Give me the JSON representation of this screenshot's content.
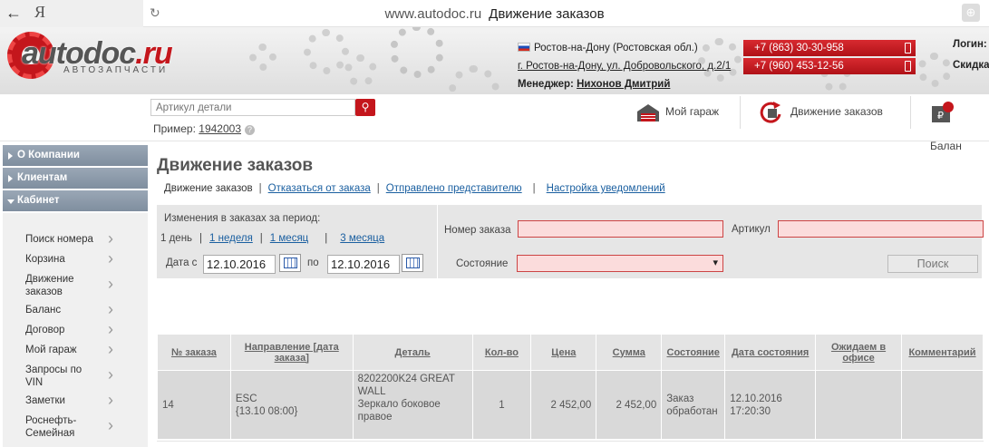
{
  "browser": {
    "back": "←",
    "yandex": "Я",
    "reload": "↻",
    "domain": "www.autodoc.ru",
    "title": "Движение заказов",
    "globe": "⊕"
  },
  "header": {
    "logo_main": "autodoc",
    "logo_ru": ".ru",
    "logo_sub": "АВТОЗАПЧАСТИ",
    "region": "Ростов-на-Дону (Ростовская обл.)",
    "address": "г. Ростов-на-Дону, ул. Добровольского, д.2/1",
    "manager_label": "Менеджер:",
    "manager_name": "Нихонов Дмитрий",
    "phones": [
      "+7 (863) 30-30-958",
      "+7 (960) 453-12-56"
    ],
    "login_label": "Логин:",
    "discount_label": "Скидка"
  },
  "search": {
    "placeholder": "Артикул детали",
    "example_label": "Пример:",
    "example_value": "1942003",
    "help": "?"
  },
  "topnav": {
    "garage": "Мой гараж",
    "orders": "Движение заказов",
    "balance": "Балан"
  },
  "sidebar": {
    "sections": [
      "О Компании",
      "Клиентам",
      "Кабинет"
    ],
    "items": [
      "Поиск номера",
      "Корзина",
      "Движение заказов",
      "Баланс",
      "Договор",
      "Мой гараж",
      "Запросы по VIN",
      "Заметки",
      "Роснефть-Семейная"
    ]
  },
  "main": {
    "title": "Движение заказов",
    "tabs": [
      "Движение заказов",
      "Отказаться от заказа",
      "Отправлено представителю",
      "Настройка уведомлений"
    ]
  },
  "filter": {
    "period_label": "Изменения в заказах за период:",
    "periods": [
      "1 день",
      "1 неделя",
      "1 месяц",
      "3 месяца"
    ],
    "date_from_label": "Дата с",
    "date_from": "12.10.2016",
    "date_to_label": "по",
    "date_to": "12.10.2016",
    "order_number_label": "Номер заказа",
    "article_label": "Артикул",
    "state_label": "Состояние",
    "search_button": "Поиск"
  },
  "table": {
    "headers": [
      "№ заказа",
      "Направление [дата заказа]",
      "Деталь",
      "Кол-во",
      "Цена",
      "Сумма",
      "Состояние",
      "Дата состояния",
      "Ожидаем в офисе",
      "Комментарий"
    ],
    "rows": [
      {
        "order": "14",
        "direction": "ESC",
        "order_date": "{13.10 08:00}",
        "part_number": "8202200K24 GREAT WALL",
        "part_name": "Зеркало боковое правое",
        "qty": "1",
        "price": "2 452,00",
        "sum": "2 452,00",
        "state": "Заказ обработан",
        "state_date": "12.10.2016 17:20:30",
        "expected": "",
        "comment": ""
      }
    ]
  },
  "colors": {
    "brand_red": "#c4161c",
    "link_blue": "#1a5fa0",
    "sidebar_header": "#8a98a9",
    "error_input": "#fbdcdc"
  }
}
